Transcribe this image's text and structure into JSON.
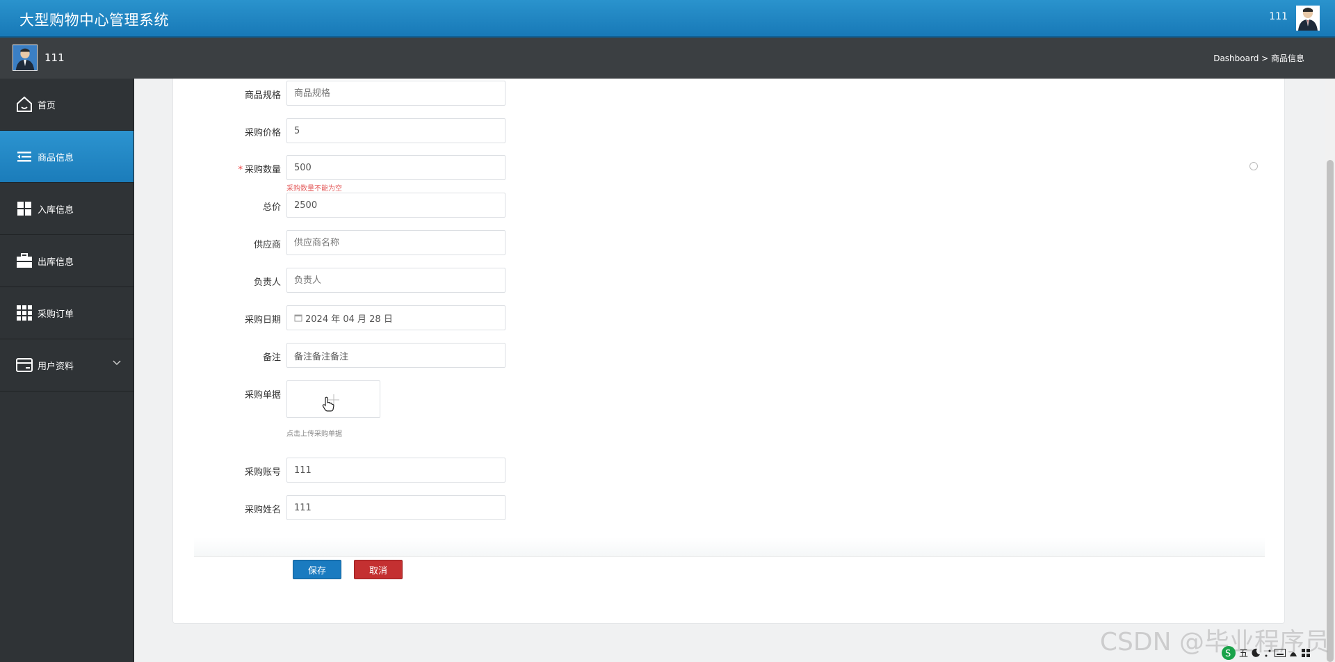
{
  "app": {
    "title": "大型购物中心管理系统",
    "user": "111"
  },
  "subbar": {
    "username": "111",
    "breadcrumb": "Dashboard > 商品信息"
  },
  "sidebar": {
    "items": [
      {
        "label": "首页",
        "icon": "home-icon"
      },
      {
        "label": "商品信息",
        "icon": "list-icon",
        "active": true
      },
      {
        "label": "入库信息",
        "icon": "grid-icon"
      },
      {
        "label": "出库信息",
        "icon": "briefcase-icon"
      },
      {
        "label": "采购订单",
        "icon": "table-icon"
      },
      {
        "label": "用户资料",
        "icon": "card-icon",
        "expandable": true
      }
    ]
  },
  "form": {
    "spec": {
      "label": "商品规格",
      "placeholder": "商品规格"
    },
    "price": {
      "label": "采购价格",
      "value": "5"
    },
    "qty": {
      "label": "采购数量",
      "value": "500",
      "error": "采购数量不能为空",
      "required": "*"
    },
    "total": {
      "label": "总价",
      "value": "2500"
    },
    "supplier": {
      "label": "供应商",
      "placeholder": "供应商名称"
    },
    "owner": {
      "label": "负责人",
      "placeholder": "负责人"
    },
    "date": {
      "label": "采购日期",
      "value": "2024 年 04 月 28 日"
    },
    "remark": {
      "label": "备注",
      "value": "备注备注备注"
    },
    "upload": {
      "label": "采购单据",
      "hint": "点击上传采购单据"
    },
    "account": {
      "label": "采购账号",
      "value": "111"
    },
    "name": {
      "label": "采购姓名",
      "value": "111"
    },
    "buttons": {
      "save": "保存",
      "cancel": "取消"
    }
  },
  "watermark": "CSDN @毕业程序员",
  "tray": {
    "ime": "五"
  },
  "colors": {
    "accent": "#1a7bc0",
    "danger": "#c43031",
    "sidebar": "#2f3336"
  }
}
